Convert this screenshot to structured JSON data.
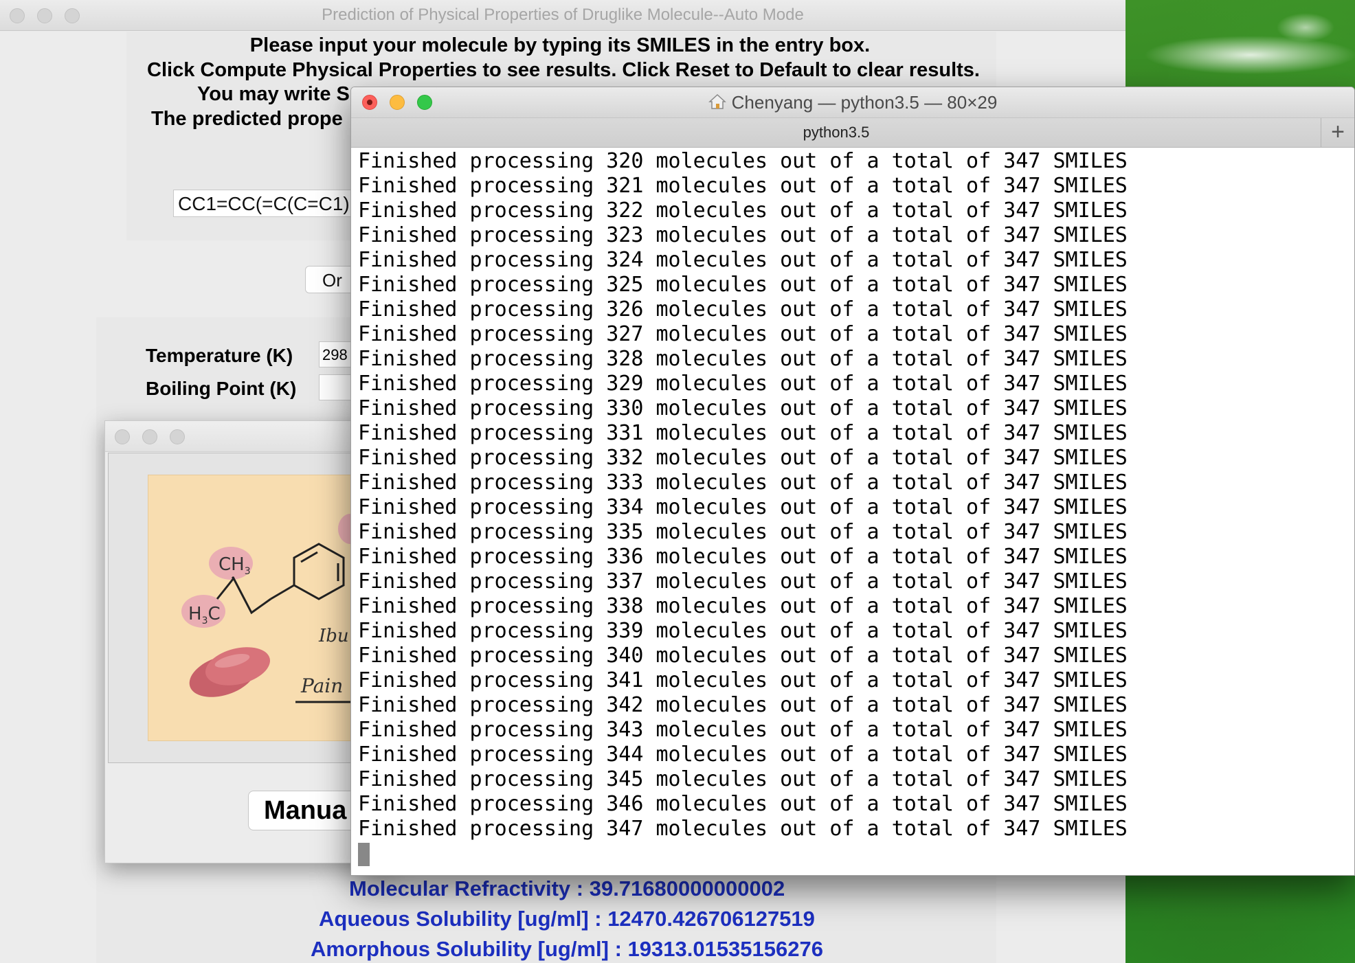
{
  "main_window": {
    "title": "Prediction of Physical Properties of Druglike Molecule--Auto Mode",
    "instructions": {
      "line1": "Please input your molecule by typing its SMILES in the entry box.",
      "line2": "Click Compute Physical Properties to see results. Click Reset to Default to clear results.",
      "line3_partial": "You may write S",
      "line4_partial": "The predicted prope"
    },
    "smiles_input_value": "CC1=CC(=C(C=C1)",
    "or_button_label": "Or",
    "temperature_label": "Temperature (K)",
    "temperature_value": "298",
    "boiling_point_label": "Boiling Point (K)",
    "boiling_point_value": "",
    "results": {
      "molecular_refractivity": "Molecular Refractivity : 39.71680000000002",
      "aqueous_solubility": "Aqueous Solubility [ug/ml] : 12470.426706127519",
      "amorphous_solubility": "Amorphous Solubility [ug/ml] : 19313.01535156276"
    },
    "colors": {
      "result_text": "#1c2fbf"
    }
  },
  "image_window": {
    "manual_button_label": "Manua",
    "image_labels": {
      "ch3": "CH",
      "ch3_sub": "3",
      "h3c": "H",
      "h3c_sub": "3",
      "h3c_c": "C",
      "ibuprofen_partial": "Ibu",
      "pain_partial": "Pain"
    }
  },
  "terminal": {
    "title": "Chenyang — python3.5 — 80×29",
    "tab_label": "python3.5",
    "new_tab_label": "+",
    "lines": [
      "Finished processing 320 molecules out of a total of 347 SMILES",
      "Finished processing 321 molecules out of a total of 347 SMILES",
      "Finished processing 322 molecules out of a total of 347 SMILES",
      "Finished processing 323 molecules out of a total of 347 SMILES",
      "Finished processing 324 molecules out of a total of 347 SMILES",
      "Finished processing 325 molecules out of a total of 347 SMILES",
      "Finished processing 326 molecules out of a total of 347 SMILES",
      "Finished processing 327 molecules out of a total of 347 SMILES",
      "Finished processing 328 molecules out of a total of 347 SMILES",
      "Finished processing 329 molecules out of a total of 347 SMILES",
      "Finished processing 330 molecules out of a total of 347 SMILES",
      "Finished processing 331 molecules out of a total of 347 SMILES",
      "Finished processing 332 molecules out of a total of 347 SMILES",
      "Finished processing 333 molecules out of a total of 347 SMILES",
      "Finished processing 334 molecules out of a total of 347 SMILES",
      "Finished processing 335 molecules out of a total of 347 SMILES",
      "Finished processing 336 molecules out of a total of 347 SMILES",
      "Finished processing 337 molecules out of a total of 347 SMILES",
      "Finished processing 338 molecules out of a total of 347 SMILES",
      "Finished processing 339 molecules out of a total of 347 SMILES",
      "Finished processing 340 molecules out of a total of 347 SMILES",
      "Finished processing 341 molecules out of a total of 347 SMILES",
      "Finished processing 342 molecules out of a total of 347 SMILES",
      "Finished processing 343 molecules out of a total of 347 SMILES",
      "Finished processing 344 molecules out of a total of 347 SMILES",
      "Finished processing 345 molecules out of a total of 347 SMILES",
      "Finished processing 346 molecules out of a total of 347 SMILES",
      "Finished processing 347 molecules out of a total of 347 SMILES"
    ],
    "traffic_light_colors": {
      "close": "#fc605b",
      "minimize": "#fdbc40",
      "zoom": "#34c84a"
    },
    "home_icon": "home-icon"
  }
}
